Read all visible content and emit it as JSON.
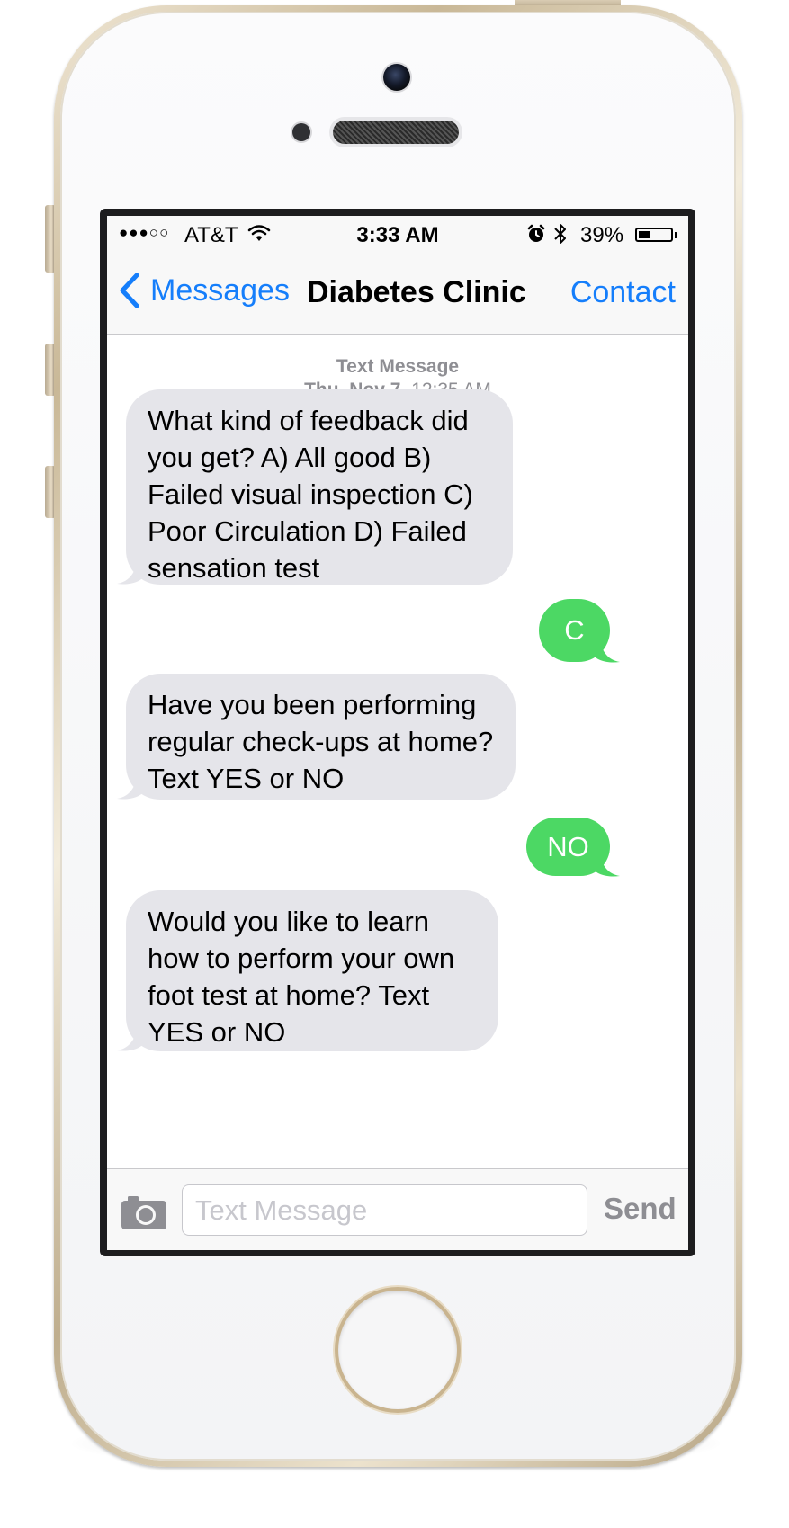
{
  "status_bar": {
    "signal": "●●●○○",
    "carrier": "AT&T",
    "time": "3:33 AM",
    "battery_percent": "39%",
    "battery_level": 0.39,
    "icons": [
      "wifi-icon",
      "alarm-icon",
      "bluetooth-icon",
      "battery-icon"
    ]
  },
  "nav": {
    "back_label": "Messages",
    "title": "Diabetes Clinic",
    "right_label": "Contact"
  },
  "thread": {
    "service": "Text Message",
    "date": "Thu, Nov 7,",
    "time": "12:35 AM"
  },
  "messages": [
    {
      "direction": "incoming",
      "text": "What kind of feedback did you get? A) All good B) Failed visual inspection C) Poor Circulation D) Failed sensation test"
    },
    {
      "direction": "outgoing",
      "text": "C"
    },
    {
      "direction": "incoming",
      "text": "Have you been performing regular check-ups at home? Text YES or NO"
    },
    {
      "direction": "outgoing",
      "text": "NO"
    },
    {
      "direction": "incoming",
      "text": "Would you like to learn how to perform your own foot test at home? Text YES or NO"
    }
  ],
  "composer": {
    "placeholder": "Text Message",
    "value": "",
    "send_label": "Send"
  },
  "colors": {
    "ios_blue": "#157efb",
    "incoming_bubble": "#e5e5ea",
    "outgoing_bubble": "#4cd864",
    "secondary_text": "#8e8e93",
    "phone_gold": "#c9b897"
  }
}
